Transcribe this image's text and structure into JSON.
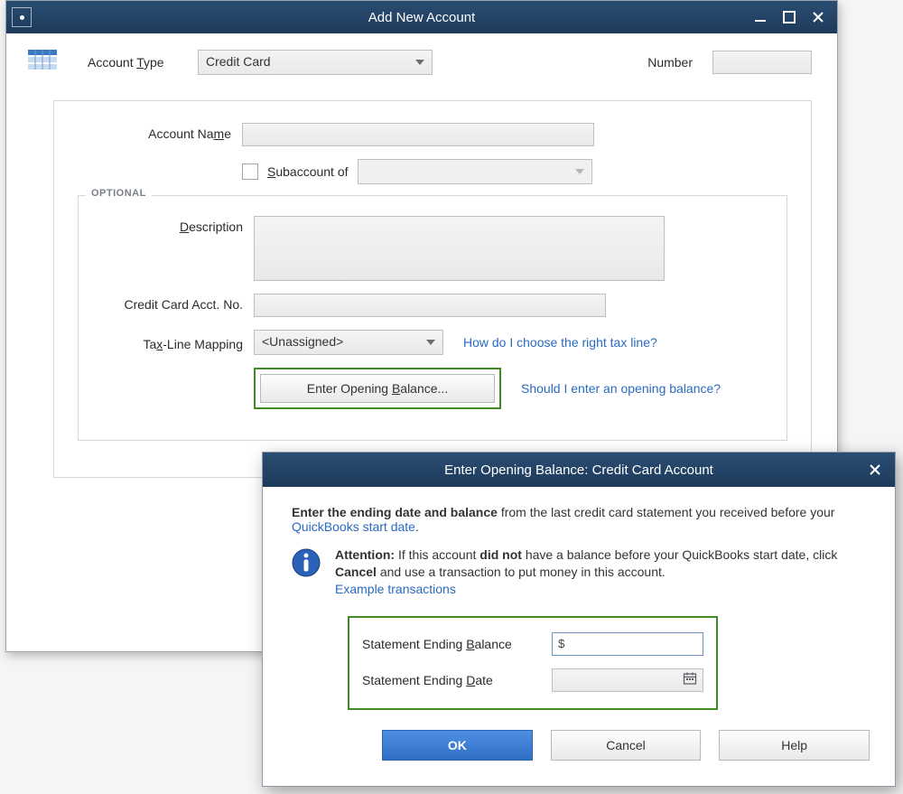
{
  "mainWindow": {
    "title": "Add New Account",
    "accountTypeLabel": "Account Type",
    "accountTypeValue": "Credit Card",
    "numberLabel": "Number",
    "numberValue": "",
    "accountNameLabel": "Account Name",
    "accountNameValue": "",
    "subaccountLabel": "Subaccount of",
    "subaccountChecked": false,
    "subaccountValue": "",
    "optionalLegend": "OPTIONAL",
    "descriptionLabel": "Description",
    "descriptionValue": "",
    "ccAcctNoLabel": "Credit Card Acct. No.",
    "ccAcctNoValue": "",
    "taxLineLabel": "Tax-Line Mapping",
    "taxLineValue": "<Unassigned>",
    "taxLineHelpLink": "How do I choose the right tax line?",
    "openingBalanceButton": "Enter Opening Balance...",
    "openingBalanceHelpLink": "Should I enter an opening balance?"
  },
  "dialog": {
    "title": "Enter Opening Balance: Credit Card Account",
    "introBold": "Enter the ending date and balance",
    "introRest": " from the last credit card statement you received before your ",
    "introLink": "QuickBooks start date",
    "introPeriod": ".",
    "attentionLabel": "Attention:",
    "attentionText1": " If this account ",
    "attentionBold": "did not",
    "attentionText2": " have a balance before your QuickBooks start date, click ",
    "attentionBold2": "Cancel",
    "attentionText3": " and use a transaction to put money in this account. ",
    "exampleLink": "Example transactions",
    "endingBalanceLabel": "Statement Ending Balance",
    "endingBalanceValue": "$",
    "endingDateLabel": "Statement Ending Date",
    "endingDateValue": "",
    "okLabel": "OK",
    "cancelLabel": "Cancel",
    "helpLabel": "Help"
  }
}
